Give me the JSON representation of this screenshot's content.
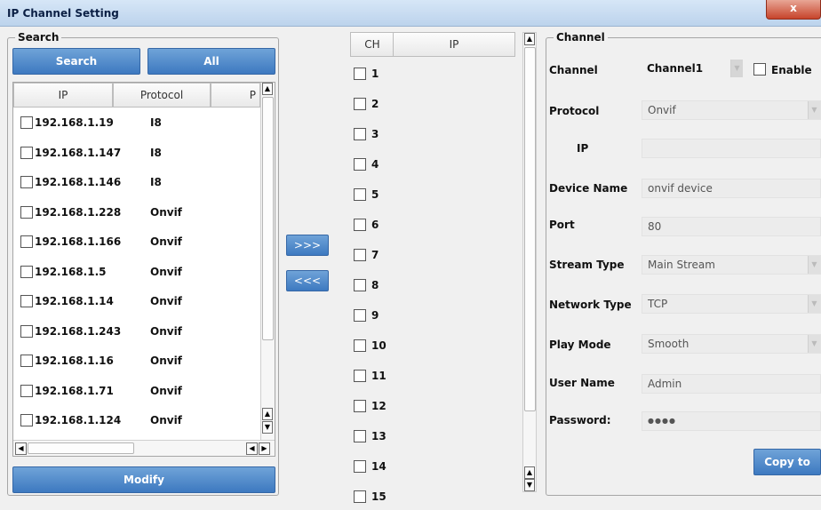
{
  "window": {
    "title": "IP Channel Setting",
    "close_label": "x"
  },
  "search": {
    "group_label": "Search",
    "search_button": "Search",
    "all_button": "All",
    "columns": [
      "IP",
      "Protocol",
      "P"
    ],
    "rows": [
      {
        "ip": "192.168.1.19",
        "protocol": "I8"
      },
      {
        "ip": "192.168.1.147",
        "protocol": "I8"
      },
      {
        "ip": "192.168.1.146",
        "protocol": "I8"
      },
      {
        "ip": "192.168.1.228",
        "protocol": "Onvif"
      },
      {
        "ip": "192.168.1.166",
        "protocol": "Onvif"
      },
      {
        "ip": "192.168.1.5",
        "protocol": "Onvif"
      },
      {
        "ip": "192.168.1.14",
        "protocol": "Onvif"
      },
      {
        "ip": "192.168.1.243",
        "protocol": "Onvif"
      },
      {
        "ip": "192.168.1.16",
        "protocol": "Onvif"
      },
      {
        "ip": "192.168.1.71",
        "protocol": "Onvif"
      },
      {
        "ip": "192.168.1.124",
        "protocol": "Onvif"
      }
    ],
    "modify_button": "Modify"
  },
  "transfer": {
    "add_label": ">>>",
    "remove_label": "<<<"
  },
  "channels": {
    "columns": [
      "CH",
      "IP"
    ],
    "rows": [
      "1",
      "2",
      "3",
      "4",
      "5",
      "6",
      "7",
      "8",
      "9",
      "10",
      "11",
      "12",
      "13",
      "14",
      "15"
    ]
  },
  "channel": {
    "group_label": "Channel",
    "channel_label": "Channel",
    "channel_value": "Channel1",
    "enable_label": "Enable",
    "protocol_label": "Protocol",
    "protocol_value": "Onvif",
    "ip_label": "IP",
    "ip_value": "",
    "device_name_label": "Device Name",
    "device_name_value": "onvif device",
    "port_label": "Port",
    "port_value": "80",
    "stream_type_label": "Stream Type",
    "stream_type_value": "Main Stream",
    "network_type_label": "Network Type",
    "network_type_value": "TCP",
    "play_mode_label": "Play Mode",
    "play_mode_value": "Smooth",
    "user_name_label": "User Name",
    "user_name_value": "Admin",
    "password_label": "Password:",
    "password_value": "●●●●",
    "copy_button": "Copy to"
  },
  "colors": {
    "accent": "#3d79c0",
    "title_bg": "#c9dcf1",
    "close": "#c7442b"
  },
  "icons": [
    "close-icon",
    "scroll-up-icon",
    "scroll-down-icon",
    "scroll-left-icon",
    "scroll-right-icon",
    "dropdown-arrow-icon"
  ]
}
